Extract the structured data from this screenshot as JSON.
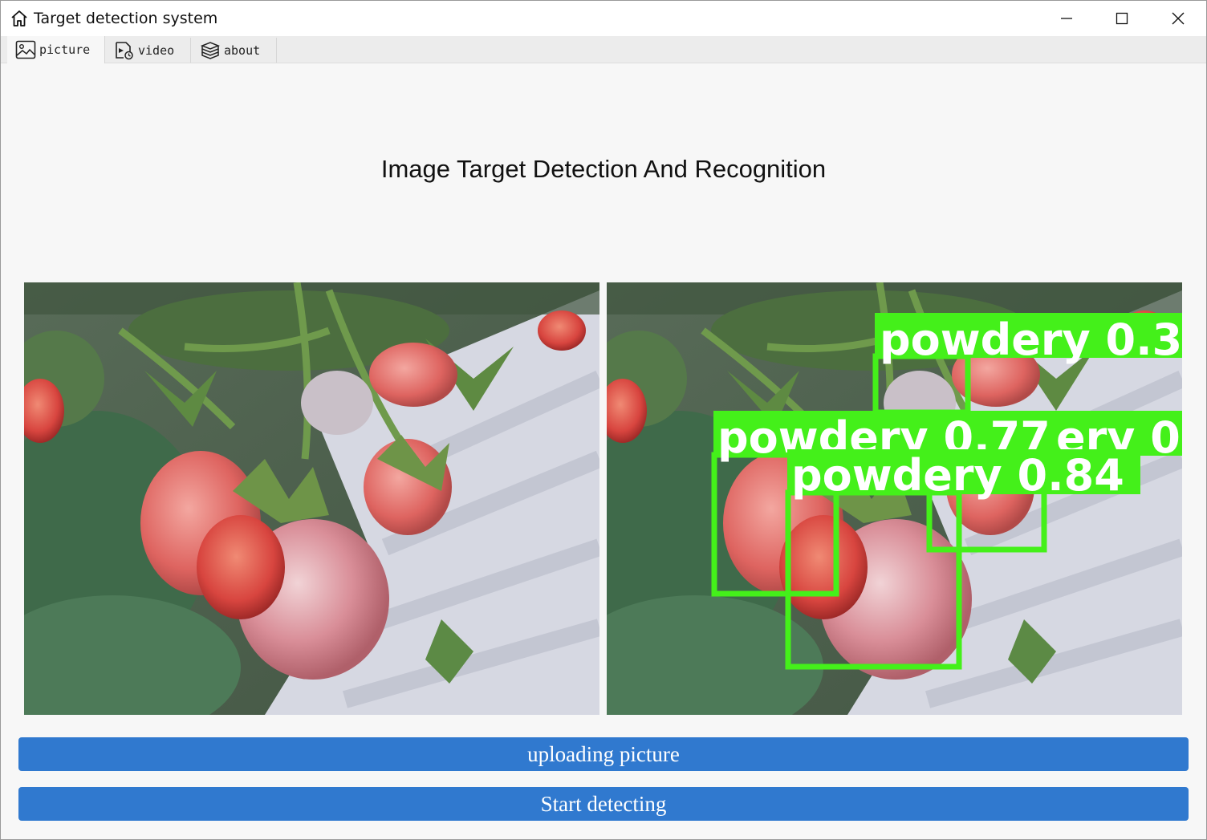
{
  "window": {
    "title": "Target detection system"
  },
  "tabs": [
    {
      "label": "picture",
      "icon": "picture-icon",
      "active": true
    },
    {
      "label": "video",
      "icon": "video-icon",
      "active": false
    },
    {
      "label": "about",
      "icon": "book-icon",
      "active": false
    }
  ],
  "main": {
    "heading": "Image Target Detection And Recognition",
    "detections": [
      {
        "label": "powdery 0.3"
      },
      {
        "label": "powdery 0.77"
      },
      {
        "label": "ery 0"
      },
      {
        "label": "powdery 0.84"
      }
    ],
    "upload_label": "uploading picture",
    "detect_label": "Start detecting"
  },
  "colors": {
    "accent": "#3079cf",
    "detection_box": "#44f01a"
  }
}
